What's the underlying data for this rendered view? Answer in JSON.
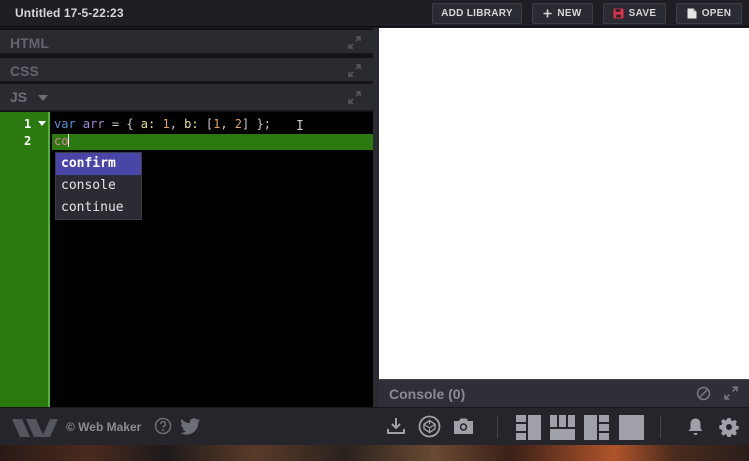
{
  "header": {
    "title": "Untitled 17-5-22:23",
    "buttons": {
      "add_library": "ADD LIBRARY",
      "new": "NEW",
      "save": "SAVE",
      "open": "OPEN"
    }
  },
  "editors": {
    "panels": [
      "HTML",
      "CSS",
      "JS"
    ],
    "active_panel": "JS"
  },
  "code": {
    "line_numbers": [
      "1",
      "2"
    ],
    "line1": {
      "kw": "var",
      "name": "arr",
      "eq": "=",
      "open": "{",
      "prop_a": "a:",
      "val_a": "1",
      "comma1": ",",
      "prop_b": "b:",
      "arr_open": "[",
      "val_b1": "1",
      "comma2": ",",
      "val_b2": "2",
      "arr_close": "]",
      "close": "};"
    },
    "line2_typed": "co"
  },
  "autocomplete": {
    "items": [
      "confirm",
      "console",
      "continue"
    ],
    "selected": "confirm"
  },
  "console": {
    "label": "Console (0)"
  },
  "footer": {
    "brand": "© Web Maker"
  },
  "colors": {
    "gutter": "#2a7a10",
    "autocomplete_selected": "#4a46a8",
    "save_icon": "#e0304a"
  },
  "icons": {
    "add": "plus-icon",
    "save": "floppy-icon",
    "open": "folder-icon",
    "expand": "expand-icon",
    "clear": "clear-console-icon",
    "help": "help-icon",
    "twitter": "twitter-icon",
    "download": "download-icon",
    "codepen": "codepen-icon",
    "screenshot": "camera-icon",
    "notifications": "bell-icon",
    "settings": "gear-icon"
  }
}
